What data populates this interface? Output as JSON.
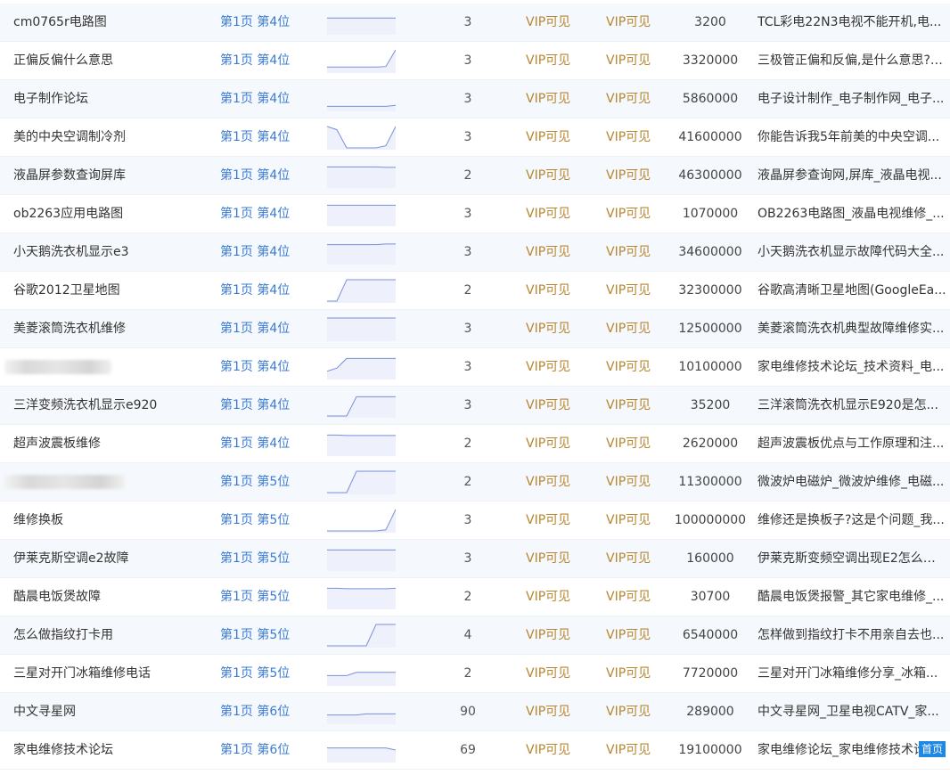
{
  "rows": [
    {
      "keyword": "cm0765r电路图",
      "rank": "第1页 第4位",
      "trend": [
        0.7,
        0.7,
        0.7,
        0.7,
        0.7,
        0.7,
        0.7,
        0.7
      ],
      "index": "3",
      "vip1": "VIP可见",
      "vip2": "VIP可见",
      "volume": "3200",
      "title": "TCL彩电22N3电视不能开机,电..."
    },
    {
      "keyword": "正偏反偏什么意思",
      "rank": "第1页 第4位",
      "trend": [
        0.2,
        0.2,
        0.2,
        0.2,
        0.2,
        0.2,
        0.22,
        1.0
      ],
      "index": "3",
      "vip1": "VIP可见",
      "vip2": "VIP可见",
      "volume": "3320000",
      "title": "三极管正偏和反偏,是什么意思?_..."
    },
    {
      "keyword": "电子制作论坛",
      "rank": "第1页 第4位",
      "trend": [
        0.15,
        0.15,
        0.15,
        0.15,
        0.15,
        0.15,
        0.15,
        0.2
      ],
      "index": "3",
      "vip1": "VIP可见",
      "vip2": "VIP可见",
      "volume": "5860000",
      "title": "电子设计制作_电子制作网_电子..."
    },
    {
      "keyword": "美的中央空调制冷剂",
      "rank": "第1页 第4位",
      "trend": [
        1.0,
        0.85,
        0.0,
        0.0,
        0.0,
        0.0,
        0.1,
        1.0
      ],
      "index": "3",
      "vip1": "VIP可见",
      "vip2": "VIP可见",
      "volume": "41600000",
      "title": "你能告诉我5年前美的中央空调..."
    },
    {
      "keyword": "液晶屏参数查询屏库",
      "rank": "第1页 第4位",
      "trend": [
        0.9,
        0.9,
        0.9,
        0.9,
        0.9,
        0.9,
        0.88,
        0.88
      ],
      "index": "2",
      "vip1": "VIP可见",
      "vip2": "VIP可见",
      "volume": "46300000",
      "title": "液晶屏参查询网,屏库_液晶电视..."
    },
    {
      "keyword": "ob2263应用电路图",
      "rank": "第1页 第4位",
      "trend": [
        0.9,
        0.9,
        0.9,
        0.9,
        0.9,
        0.9,
        0.9,
        0.9
      ],
      "index": "3",
      "vip1": "VIP可见",
      "vip2": "VIP可见",
      "volume": "1070000",
      "title": "OB2263电路图_液晶电视维修_..."
    },
    {
      "keyword": "小天鹅洗衣机显示e3",
      "rank": "第1页 第4位",
      "trend": [
        0.85,
        0.85,
        0.85,
        0.85,
        0.85,
        0.85,
        0.88,
        0.88
      ],
      "index": "3",
      "vip1": "VIP可见",
      "vip2": "VIP可见",
      "volume": "34600000",
      "title": "小天鹅洗衣机显示故障代码大全..."
    },
    {
      "keyword": "谷歌2012卫星地图",
      "rank": "第1页 第4位",
      "trend": [
        0.0,
        0.0,
        1.0,
        1.0,
        1.0,
        1.0,
        1.0,
        1.0
      ],
      "index": "2",
      "vip1": "VIP可见",
      "vip2": "VIP可见",
      "volume": "32300000",
      "title": "谷歌高清晰卫星地图(GoogleEa..."
    },
    {
      "keyword": "美菱滚筒洗衣机维修",
      "rank": "第1页 第4位",
      "trend": [
        1.0,
        1.0,
        1.0,
        1.0,
        1.0,
        1.0,
        1.0,
        1.0
      ],
      "index": "3",
      "vip1": "VIP可见",
      "vip2": "VIP可见",
      "volume": "12500000",
      "title": "美菱滚筒洗衣机典型故障维修实..."
    },
    {
      "keyword": "",
      "rank": "第1页 第4位",
      "trend": [
        0.3,
        0.45,
        0.9,
        0.9,
        0.9,
        0.9,
        0.9,
        0.9
      ],
      "index": "3",
      "vip1": "VIP可见",
      "vip2": "VIP可见",
      "volume": "10100000",
      "title": "家电维修技术论坛_技术资料_电..."
    },
    {
      "keyword": "三洋变频洗衣机显示e920",
      "rank": "第1页 第4位",
      "trend": [
        0.0,
        0.0,
        0.0,
        0.9,
        0.9,
        0.9,
        0.9,
        0.9
      ],
      "index": "3",
      "vip1": "VIP可见",
      "vip2": "VIP可见",
      "volume": "35200",
      "title": "三洋滚筒洗衣机显示E920是怎..."
    },
    {
      "keyword": "超声波震板维修",
      "rank": "第1页 第4位",
      "trend": [
        0.9,
        0.9,
        0.88,
        0.88,
        0.88,
        0.88,
        0.88,
        0.88
      ],
      "index": "2",
      "vip1": "VIP可见",
      "vip2": "VIP可见",
      "volume": "2620000",
      "title": "超声波震板优点与工作原理和注..."
    },
    {
      "keyword": "",
      "rank": "第1页 第5位",
      "trend": [
        0.0,
        0.0,
        0.0,
        1.0,
        1.0,
        1.0,
        1.0,
        1.0
      ],
      "index": "2",
      "vip1": "VIP可见",
      "vip2": "VIP可见",
      "volume": "11300000",
      "title": "微波炉电磁炉_微波炉维修_电磁..."
    },
    {
      "keyword": "维修换板",
      "rank": "第1页 第5位",
      "trend": [
        0.0,
        0.0,
        0.0,
        0.0,
        0.0,
        0.0,
        0.05,
        1.0
      ],
      "index": "3",
      "vip1": "VIP可见",
      "vip2": "VIP可见",
      "volume": "100000000",
      "title": "维修还是换板子?这是个问题_我..."
    },
    {
      "keyword": "伊莱克斯空调e2故障",
      "rank": "第1页 第5位",
      "trend": [
        0.9,
        0.9,
        0.9,
        0.9,
        0.9,
        0.9,
        0.9,
        0.9
      ],
      "index": "3",
      "vip1": "VIP可见",
      "vip2": "VIP可见",
      "volume": "160000",
      "title": "伊莱克斯变频空调出现E2怎么检..."
    },
    {
      "keyword": "酷晨电饭煲故障",
      "rank": "第1页 第5位",
      "trend": [
        0.9,
        0.9,
        0.88,
        0.88,
        0.88,
        0.88,
        0.88,
        0.9
      ],
      "index": "2",
      "vip1": "VIP可见",
      "vip2": "VIP可见",
      "volume": "30700",
      "title": "酷晨电饭煲报警_其它家电维修_..."
    },
    {
      "keyword": "怎么做指纹打卡用",
      "rank": "第1页 第5位",
      "trend": [
        0.0,
        0.0,
        0.0,
        0.0,
        0.0,
        1.0,
        1.0,
        1.0
      ],
      "index": "4",
      "vip1": "VIP可见",
      "vip2": "VIP可见",
      "volume": "6540000",
      "title": "怎样做到指纹打卡不用亲自去也..."
    },
    {
      "keyword": "三星对开门冰箱维修电话",
      "rank": "第1页 第5位",
      "trend": [
        0.4,
        0.4,
        0.4,
        0.55,
        0.55,
        0.55,
        0.55,
        0.55
      ],
      "index": "2",
      "vip1": "VIP可见",
      "vip2": "VIP可见",
      "volume": "7720000",
      "title": "三星对开门冰箱维修分享_冰箱..."
    },
    {
      "keyword": "中文寻星网",
      "rank": "第1页 第6位",
      "trend": [
        0.35,
        0.35,
        0.35,
        0.35,
        0.4,
        0.4,
        0.4,
        0.4
      ],
      "index": "90",
      "vip1": "VIP可见",
      "vip2": "VIP可见",
      "volume": "289000",
      "title": "中文寻星网_卫星电视CATV_家..."
    },
    {
      "keyword": "家电维修技术论坛",
      "rank": "第1页 第6位",
      "trend": [
        0.6,
        0.6,
        0.6,
        0.6,
        0.6,
        0.6,
        0.6,
        0.5
      ],
      "index": "69",
      "vip1": "VIP可见",
      "vip2": "VIP可见",
      "volume": "19100000",
      "title": "家电维修论坛_家电维修技术论坛..."
    }
  ],
  "home_button": "首页",
  "colors": {
    "rank_link": "#3b7bd4",
    "vip": "#b8862f",
    "trend_line": "#7a8fd8",
    "trend_fill": "#eef1fb",
    "row_alt": "#f5f8fc",
    "home_button": "#1e88e5"
  }
}
